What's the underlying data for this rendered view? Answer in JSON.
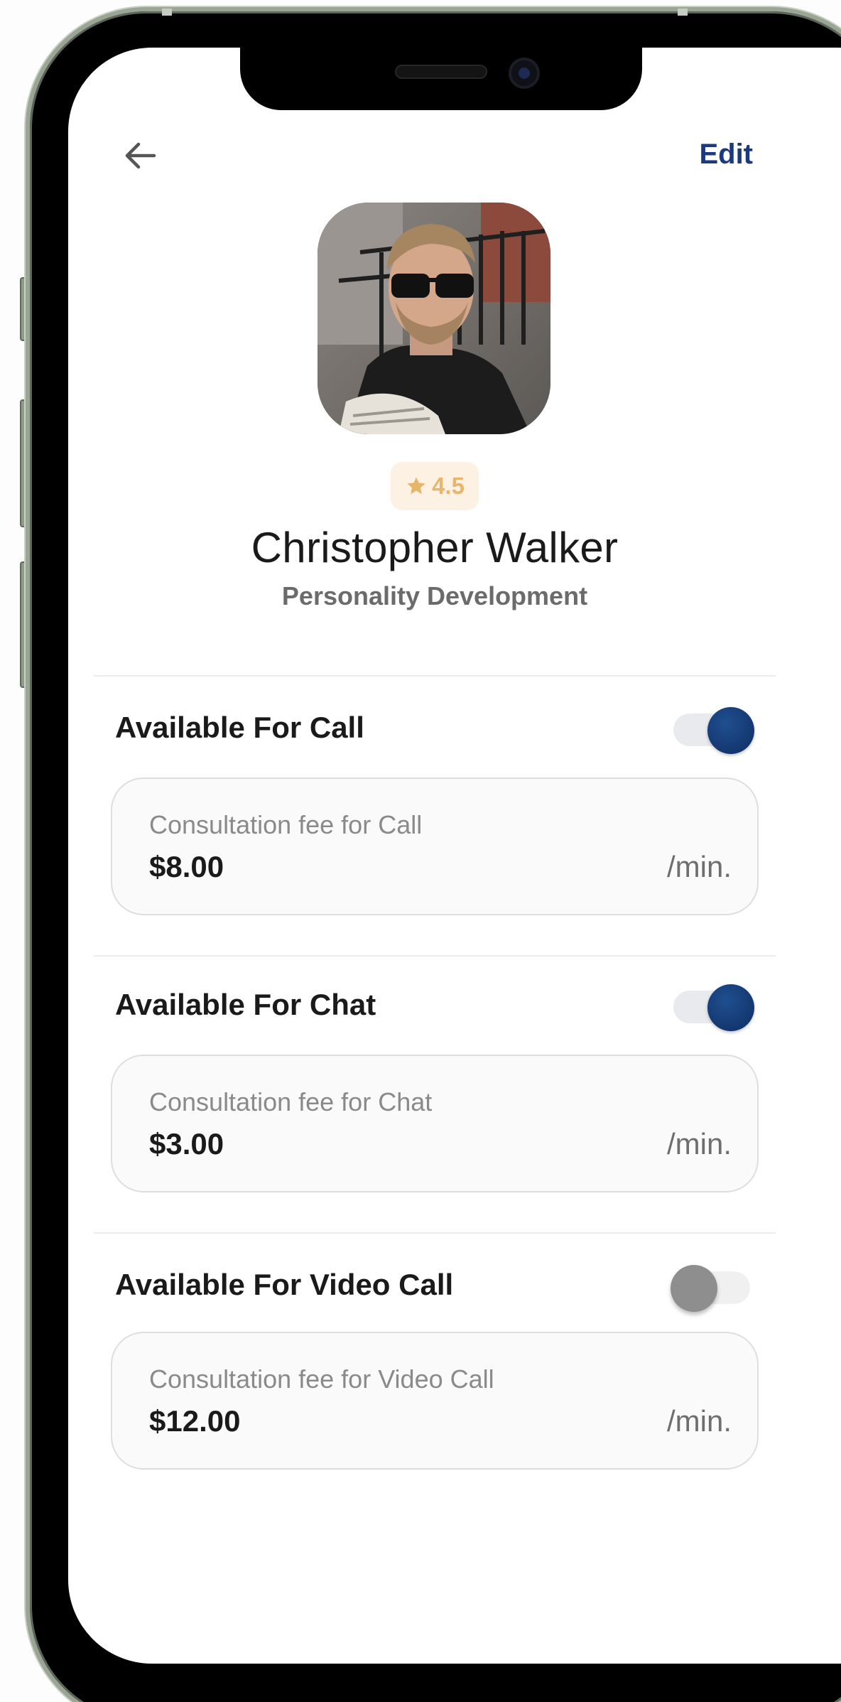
{
  "header": {
    "back_icon": "arrow-left-icon",
    "edit_label": "Edit"
  },
  "profile": {
    "rating": "4.5",
    "rating_icon": "star-icon",
    "name": "Christopher Walker",
    "specialty": "Personality Development"
  },
  "services": [
    {
      "title": "Available For Call",
      "enabled": true,
      "fee_label": "Consultation fee for Call",
      "fee": "$8.00",
      "unit": "/min."
    },
    {
      "title": "Available For Chat",
      "enabled": true,
      "fee_label": "Consultation fee for Chat",
      "fee": "$3.00",
      "unit": "/min."
    },
    {
      "title": "Available For Video Call",
      "enabled": false,
      "fee_label": "Consultation fee for Video Call",
      "fee": "$12.00",
      "unit": "/min."
    }
  ],
  "colors": {
    "accent": "#1b3a7e",
    "toggle_on": "#173f7a",
    "rating_bg": "#fcf1e3",
    "rating_fg": "#e5b66b"
  }
}
